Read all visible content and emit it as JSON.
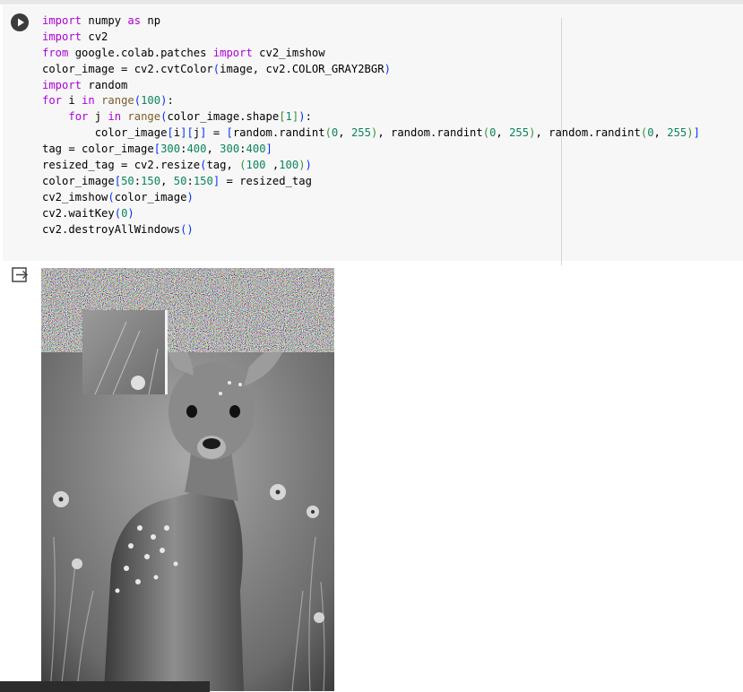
{
  "code_cell": {
    "lines": [
      [
        {
          "t": "import",
          "c": "kw"
        },
        {
          "t": " numpy "
        },
        {
          "t": "as",
          "c": "kw"
        },
        {
          "t": " np"
        }
      ],
      [
        {
          "t": "import",
          "c": "kw"
        },
        {
          "t": " cv2"
        }
      ],
      [
        {
          "t": "from",
          "c": "kw"
        },
        {
          "t": " google.colab.patches "
        },
        {
          "t": "import",
          "c": "kw"
        },
        {
          "t": " cv2_imshow"
        }
      ],
      [
        {
          "t": "color_image = cv2.cvtColor"
        },
        {
          "t": "(",
          "c": "br1"
        },
        {
          "t": "image, cv2.COLOR_GRAY2BGR"
        },
        {
          "t": ")",
          "c": "br1"
        }
      ],
      [
        {
          "t": "import",
          "c": "kw"
        },
        {
          "t": " random"
        }
      ],
      [
        {
          "t": "for",
          "c": "kw"
        },
        {
          "t": " i "
        },
        {
          "t": "in",
          "c": "kw"
        },
        {
          "t": " "
        },
        {
          "t": "range",
          "c": "fn"
        },
        {
          "t": "(",
          "c": "br1"
        },
        {
          "t": "100",
          "c": "num"
        },
        {
          "t": ")",
          "c": "br1"
        },
        {
          "t": ":"
        }
      ],
      [
        {
          "t": "    "
        },
        {
          "t": "for",
          "c": "kw"
        },
        {
          "t": " j "
        },
        {
          "t": "in",
          "c": "kw"
        },
        {
          "t": " "
        },
        {
          "t": "range",
          "c": "fn"
        },
        {
          "t": "(",
          "c": "br1"
        },
        {
          "t": "color_image.shape"
        },
        {
          "t": "[",
          "c": "br2"
        },
        {
          "t": "1",
          "c": "num"
        },
        {
          "t": "]",
          "c": "br2"
        },
        {
          "t": ")",
          "c": "br1"
        },
        {
          "t": ":"
        }
      ],
      [
        {
          "t": "        color_image"
        },
        {
          "t": "[",
          "c": "br1"
        },
        {
          "t": "i"
        },
        {
          "t": "]",
          "c": "br1"
        },
        {
          "t": "[",
          "c": "br1"
        },
        {
          "t": "j"
        },
        {
          "t": "]",
          "c": "br1"
        },
        {
          "t": " = "
        },
        {
          "t": "[",
          "c": "br1"
        },
        {
          "t": "random.randint"
        },
        {
          "t": "(",
          "c": "br2"
        },
        {
          "t": "0",
          "c": "num"
        },
        {
          "t": ", "
        },
        {
          "t": "255",
          "c": "num"
        },
        {
          "t": ")",
          "c": "br2"
        },
        {
          "t": ", random.randint"
        },
        {
          "t": "(",
          "c": "br2"
        },
        {
          "t": "0",
          "c": "num"
        },
        {
          "t": ", "
        },
        {
          "t": "255",
          "c": "num"
        },
        {
          "t": ")",
          "c": "br2"
        },
        {
          "t": ", random.randint"
        },
        {
          "t": "(",
          "c": "br2"
        },
        {
          "t": "0",
          "c": "num"
        },
        {
          "t": ", "
        },
        {
          "t": "255",
          "c": "num"
        },
        {
          "t": ")",
          "c": "br2"
        },
        {
          "t": "]",
          "c": "br1"
        }
      ],
      [
        {
          "t": "tag = color_image"
        },
        {
          "t": "[",
          "c": "br1"
        },
        {
          "t": "300",
          "c": "num"
        },
        {
          "t": ":"
        },
        {
          "t": "400",
          "c": "num"
        },
        {
          "t": ", "
        },
        {
          "t": "300",
          "c": "num"
        },
        {
          "t": ":"
        },
        {
          "t": "400",
          "c": "num"
        },
        {
          "t": "]",
          "c": "br1"
        }
      ],
      [
        {
          "t": "resized_tag = cv2.resize"
        },
        {
          "t": "(",
          "c": "br1"
        },
        {
          "t": "tag, "
        },
        {
          "t": "(",
          "c": "br2"
        },
        {
          "t": "100",
          "c": "num"
        },
        {
          "t": " ,"
        },
        {
          "t": "100",
          "c": "num"
        },
        {
          "t": ")",
          "c": "br2"
        },
        {
          "t": ")",
          "c": "br1"
        }
      ],
      [
        {
          "t": "color_image"
        },
        {
          "t": "[",
          "c": "br1"
        },
        {
          "t": "50",
          "c": "num"
        },
        {
          "t": ":"
        },
        {
          "t": "150",
          "c": "num"
        },
        {
          "t": ", "
        },
        {
          "t": "50",
          "c": "num"
        },
        {
          "t": ":"
        },
        {
          "t": "150",
          "c": "num"
        },
        {
          "t": "]",
          "c": "br1"
        },
        {
          "t": " = resized_tag"
        }
      ],
      [
        {
          "t": "cv2_imshow"
        },
        {
          "t": "(",
          "c": "br1"
        },
        {
          "t": "color_image"
        },
        {
          "t": ")",
          "c": "br1"
        }
      ],
      [
        {
          "t": "cv2.waitKey"
        },
        {
          "t": "(",
          "c": "br1"
        },
        {
          "t": "0",
          "c": "num"
        },
        {
          "t": ")",
          "c": "br1"
        }
      ],
      [
        {
          "t": "cv2.destroyAllWindows"
        },
        {
          "t": "()",
          "c": "br1"
        }
      ]
    ]
  },
  "icons": {
    "run": "play-circle-icon",
    "output": "output-redirect-icon"
  },
  "colors": {
    "keyword": "#af00db",
    "function": "#795e26",
    "number": "#098658",
    "bracket_level1": "#0431fa",
    "bracket_level2": "#319331",
    "cell_background": "#f7f7f7",
    "run_button": "#3c3c3c"
  }
}
